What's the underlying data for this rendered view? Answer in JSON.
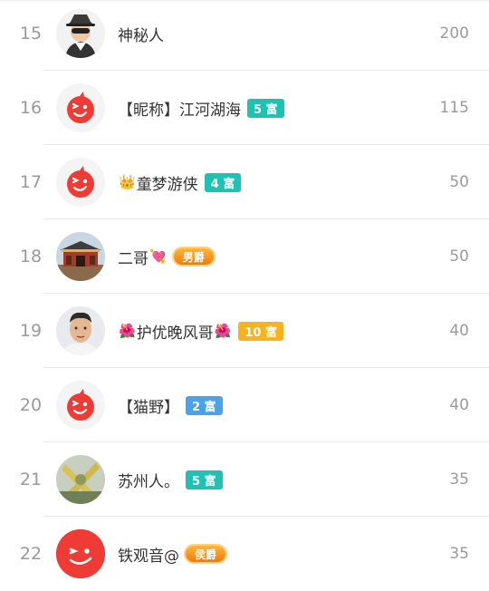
{
  "rows": [
    {
      "rank": "15",
      "name": "神秘人",
      "prefix": "",
      "suffix": "",
      "badge": "",
      "title": "",
      "score": "200",
      "avatar": "incognito"
    },
    {
      "rank": "16",
      "name": "【昵称】江河湖海",
      "prefix": "",
      "suffix": "",
      "badge": "5 富",
      "title": "",
      "score": "115",
      "avatar": "logo"
    },
    {
      "rank": "17",
      "name": "童梦游侠",
      "prefix": "👑",
      "suffix": "",
      "badge": "4 富",
      "title": "",
      "score": "50",
      "avatar": "logo"
    },
    {
      "rank": "18",
      "name": "二哥",
      "prefix": "",
      "suffix": "💘",
      "badge": "",
      "title": "男爵",
      "score": "50",
      "avatar": "gate-photo"
    },
    {
      "rank": "19",
      "name": "护优晚风哥",
      "prefix": "🌺",
      "suffix": "🌺",
      "badge": "10 富",
      "title": "",
      "score": "40",
      "avatar": "man-photo"
    },
    {
      "rank": "20",
      "name": "【猫野】",
      "prefix": "",
      "suffix": "",
      "badge": "2 富",
      "title": "",
      "score": "40",
      "avatar": "logo"
    },
    {
      "rank": "21",
      "name": "苏州人。",
      "prefix": "",
      "suffix": "",
      "badge": "5 富",
      "title": "",
      "score": "35",
      "avatar": "plant-photo"
    },
    {
      "rank": "22",
      "name": "铁观音@",
      "prefix": "",
      "suffix": "",
      "badge": "",
      "title": "侯爵",
      "score": "35",
      "avatar": "logo-red"
    }
  ],
  "colors": {
    "badge_teal": "#1ec1b2",
    "badge_yellow": "#f7b21d",
    "badge_blue": "#4aa3ea",
    "logo_red": "#ef3b36"
  }
}
